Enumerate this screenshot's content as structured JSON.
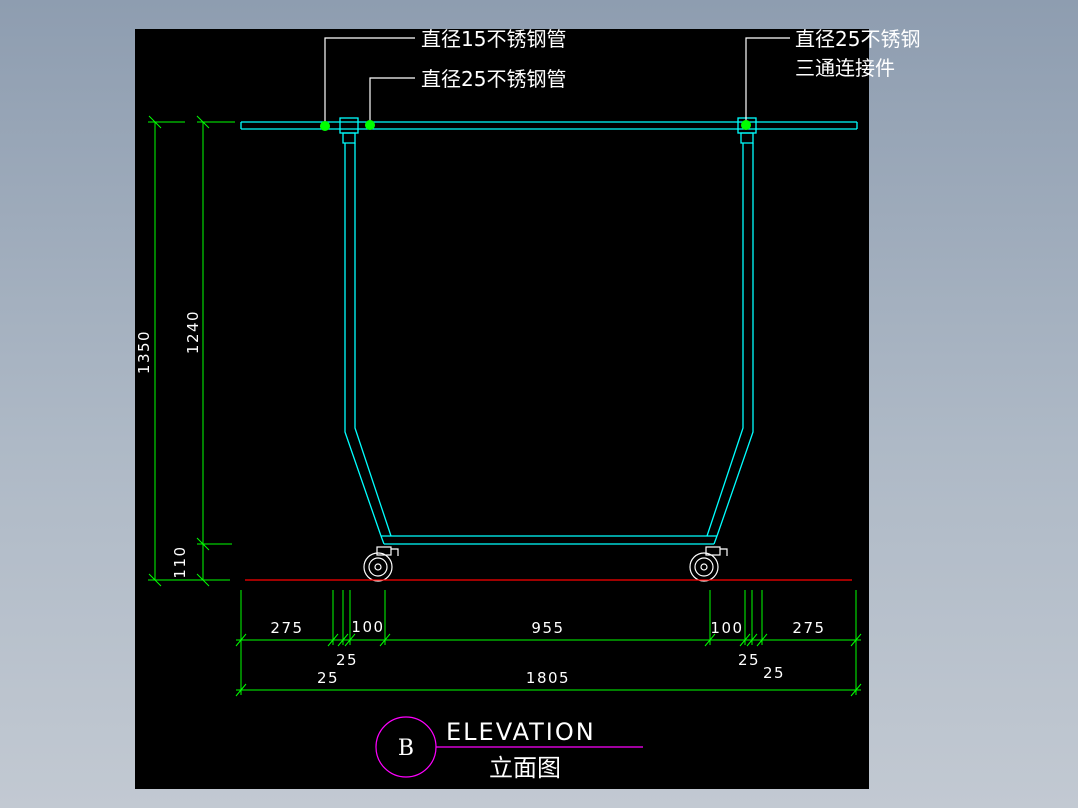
{
  "labels": {
    "pipe15": "直径15不锈钢管",
    "pipe25": "直径25不锈钢管",
    "tee_line1": "直径25不锈钢",
    "tee_line2": "三通连接件"
  },
  "dimensions": {
    "total_height": "1350",
    "frame_height": "1240",
    "caster_height": "110",
    "left_overhang": "275",
    "right_overhang": "275",
    "left_gap_a": "25",
    "left_gap_b": "25",
    "left_100": "100",
    "right_100": "100",
    "right_gap_a": "25",
    "right_gap_b": "25",
    "center_span": "955",
    "total_width": "1805"
  },
  "title": {
    "mark": "B",
    "english": "ELEVATION",
    "chinese": "立面图"
  },
  "colors": {
    "canvas": "#000000",
    "pipe": "#00ffff",
    "dimension": "#00ff00",
    "floor": "#ff0000",
    "title_mark": "#ff00ff",
    "leader_dot": "#00ff00"
  }
}
